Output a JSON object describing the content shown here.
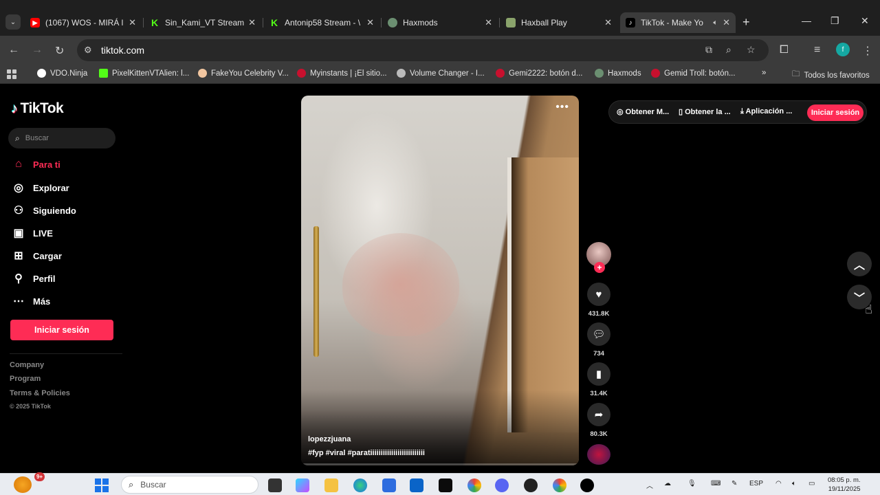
{
  "browser": {
    "tabs": [
      {
        "title": "(1067) WOS - MIRÁ l",
        "favicon_color": "#ff0000"
      },
      {
        "title": "Sin_Kami_VT Stream",
        "favicon_color": "#53fc18"
      },
      {
        "title": "Antonip58 Stream - \\",
        "favicon_color": "#53fc18"
      },
      {
        "title": "Haxmods",
        "favicon_color": "#6b8f71"
      },
      {
        "title": "Haxball Play",
        "favicon_color": "#8aa36b"
      },
      {
        "title": "TikTok - Make Yo",
        "favicon_color": "#000000",
        "active": true
      }
    ],
    "url": "tiktok.com",
    "profile_initial": "f",
    "bookmarks": [
      {
        "label": "VDO.Ninja",
        "color": "#ffffff"
      },
      {
        "label": "PixelKittenVTAlien: l...",
        "color": "#53fc18"
      },
      {
        "label": "FakeYou Celebrity V...",
        "color": "#f2c6a0"
      },
      {
        "label": "Myinstants | ¡El sitio...",
        "color": "#c8102e"
      },
      {
        "label": "Volume Changer - I...",
        "color": "#bbbbbb"
      },
      {
        "label": "Gemi2222: botón d...",
        "color": "#c8102e"
      },
      {
        "label": "Haxmods",
        "color": "#6b8f71"
      },
      {
        "label": "Gemid Troll: botón...",
        "color": "#c8102e"
      }
    ],
    "more_bookmarks_glyph": "»",
    "all_favorites": "Todos los favoritos"
  },
  "tiktok": {
    "brand": "TikTok",
    "search_placeholder": "Buscar",
    "nav": [
      {
        "label": "Para ti",
        "icon": "home-icon",
        "active": true
      },
      {
        "label": "Explorar",
        "icon": "compass-icon"
      },
      {
        "label": "Siguiendo",
        "icon": "following-icon"
      },
      {
        "label": "LIVE",
        "icon": "live-icon"
      },
      {
        "label": "Cargar",
        "icon": "upload-icon"
      },
      {
        "label": "Perfil",
        "icon": "profile-icon"
      },
      {
        "label": "Más",
        "icon": "more-icon"
      }
    ],
    "login_label": "Iniciar sesión",
    "footer": [
      "Company",
      "Program",
      "Terms & Policies"
    ],
    "copyright": "© 2025 TikTok",
    "top_actions": [
      "Obtener M...",
      "Obtener la ...",
      "Aplicación ..."
    ],
    "top_login": "Iniciar sesión",
    "video": {
      "username": "lopezzjuana",
      "caption": "#fyp #viral #paratiiiiiiiiiiiiiiiiiiiiiiiiii"
    },
    "actions": {
      "likes": "431.8K",
      "comments": "734",
      "saves": "31.4K",
      "shares": "80.3K"
    },
    "accent_color": "#fe2c55"
  },
  "taskbar": {
    "notification_count": "9+",
    "search_placeholder": "Buscar",
    "language": "ESP",
    "time": "08:05 p. m.",
    "date": "19/11/2025"
  }
}
